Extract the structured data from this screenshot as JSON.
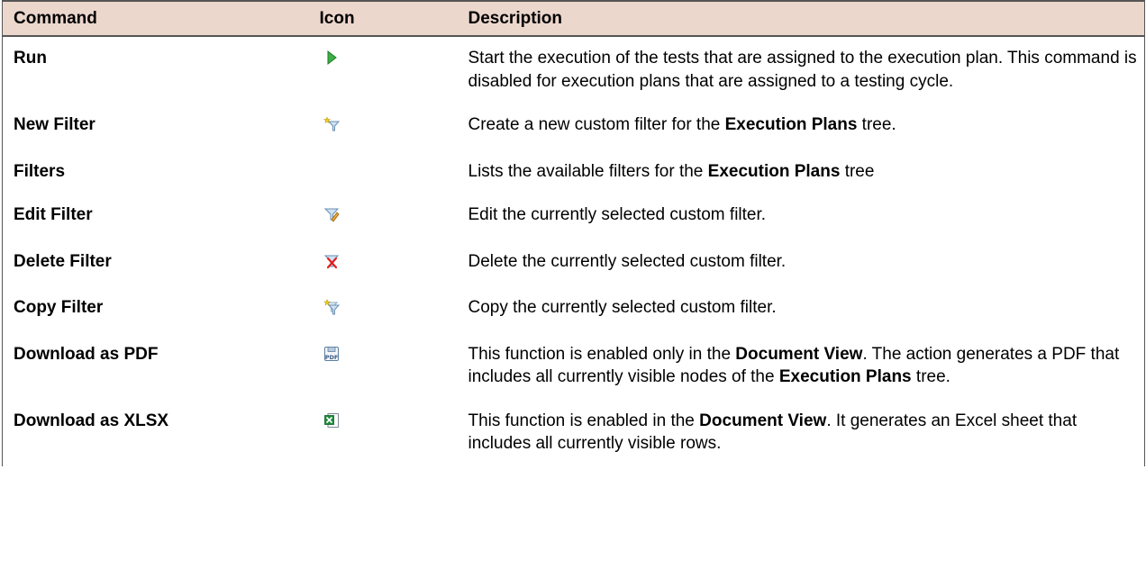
{
  "headers": {
    "command": "Command",
    "icon": "Icon",
    "description": "Description"
  },
  "rows": [
    {
      "command": "Run",
      "icon": "run-play-icon",
      "desc": [
        {
          "t": "Start the execution of the tests that are assigned to the execution plan. This command is disabled for execution plans that are assigned to a testing cycle."
        }
      ]
    },
    {
      "command": "New Filter",
      "icon": "new-filter-icon",
      "desc": [
        {
          "t": "Create a new custom filter for the "
        },
        {
          "t": "Execution Plans",
          "b": true
        },
        {
          "t": " tree."
        }
      ]
    },
    {
      "command": "Filters",
      "icon": "",
      "desc": [
        {
          "t": "Lists the available filters for the "
        },
        {
          "t": "Execution Plans",
          "b": true
        },
        {
          "t": " tree"
        }
      ]
    },
    {
      "command": "Edit Filter",
      "icon": "edit-filter-icon",
      "desc": [
        {
          "t": "Edit the currently selected custom filter."
        }
      ]
    },
    {
      "command": "Delete Filter",
      "icon": "delete-filter-icon",
      "desc": [
        {
          "t": "Delete the currently selected custom filter."
        }
      ]
    },
    {
      "command": "Copy Filter",
      "icon": "copy-filter-icon",
      "desc": [
        {
          "t": "Copy the currently selected custom filter."
        }
      ]
    },
    {
      "command": "Download as PDF",
      "icon": "pdf-download-icon",
      "desc": [
        {
          "t": "This function is enabled only in the "
        },
        {
          "t": "Document View",
          "b": true
        },
        {
          "t": ". The action generates a PDF that includes all currently visible nodes of the "
        },
        {
          "t": "Execution Plans",
          "b": true
        },
        {
          "t": " tree."
        }
      ]
    },
    {
      "command": "Download as XLSX",
      "icon": "xlsx-download-icon",
      "desc": [
        {
          "t": "This function is enabled in the "
        },
        {
          "t": "Document View",
          "b": true
        },
        {
          "t": ". It generates an Excel sheet that includes all currently visible rows."
        }
      ]
    }
  ]
}
